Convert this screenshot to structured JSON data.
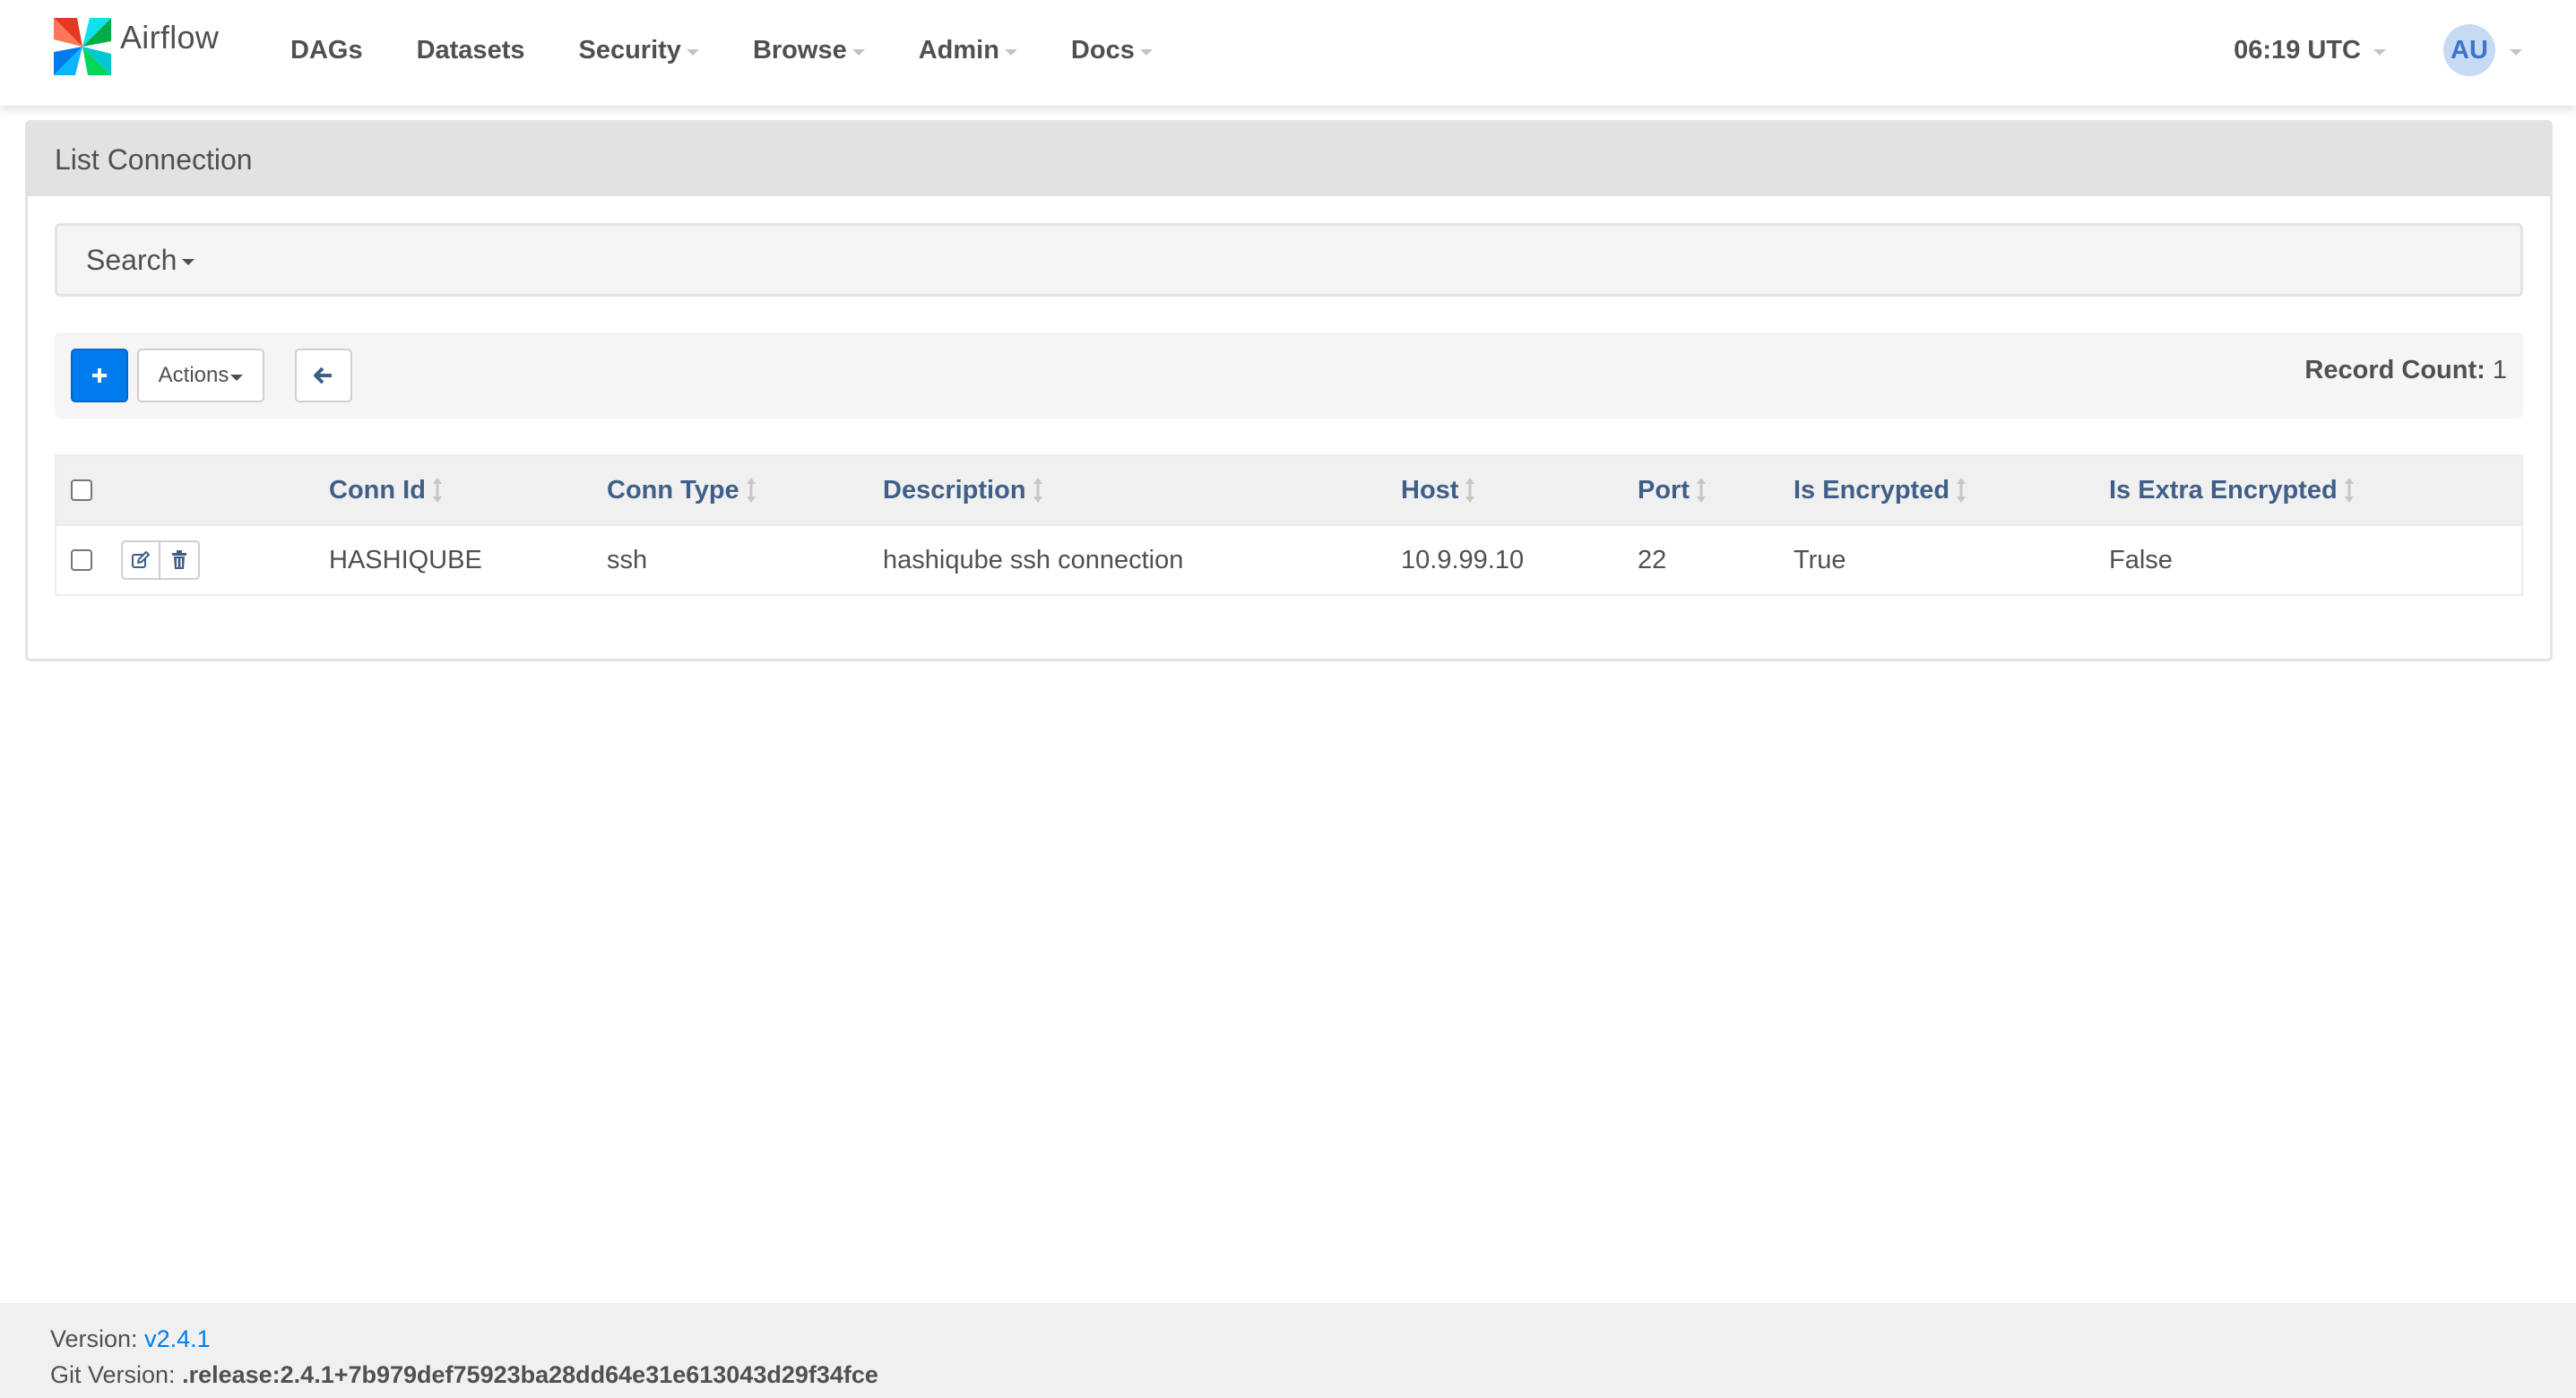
{
  "brand": {
    "name": "Airflow",
    "logo_icon": "airflow-pinwheel-icon"
  },
  "nav": {
    "items": [
      {
        "label": "DAGs",
        "dropdown": false
      },
      {
        "label": "Datasets",
        "dropdown": false
      },
      {
        "label": "Security",
        "dropdown": true
      },
      {
        "label": "Browse",
        "dropdown": true
      },
      {
        "label": "Admin",
        "dropdown": true
      },
      {
        "label": "Docs",
        "dropdown": true
      }
    ],
    "clock": "06:19 UTC",
    "user_initials": "AU"
  },
  "panel": {
    "title": "List Connection",
    "search_label": "Search",
    "actions_label": "Actions",
    "add_icon": "plus-icon",
    "back_icon": "arrow-left-icon",
    "record_count_label": "Record Count:",
    "record_count_value": "1"
  },
  "table": {
    "columns": [
      "Conn Id",
      "Conn Type",
      "Description",
      "Host",
      "Port",
      "Is Encrypted",
      "Is Extra Encrypted"
    ],
    "rows": [
      {
        "conn_id": "HASHIQUBE",
        "conn_type": "ssh",
        "description": "hashiqube ssh connection",
        "host": "10.9.99.10",
        "port": "22",
        "is_encrypted": "True",
        "is_extra_encrypted": "False"
      }
    ]
  },
  "footer": {
    "version_label": "Version:",
    "version_value": "v2.4.1",
    "git_label": "Git Version:",
    "git_value": ".release:2.4.1+7b979def75923ba28dd64e31e613043d29f34fce"
  },
  "colors": {
    "accent": "#017cee",
    "header_text": "#3f5f88",
    "body_text": "#51504f",
    "panel_heading_bg": "#e2e2e2"
  }
}
